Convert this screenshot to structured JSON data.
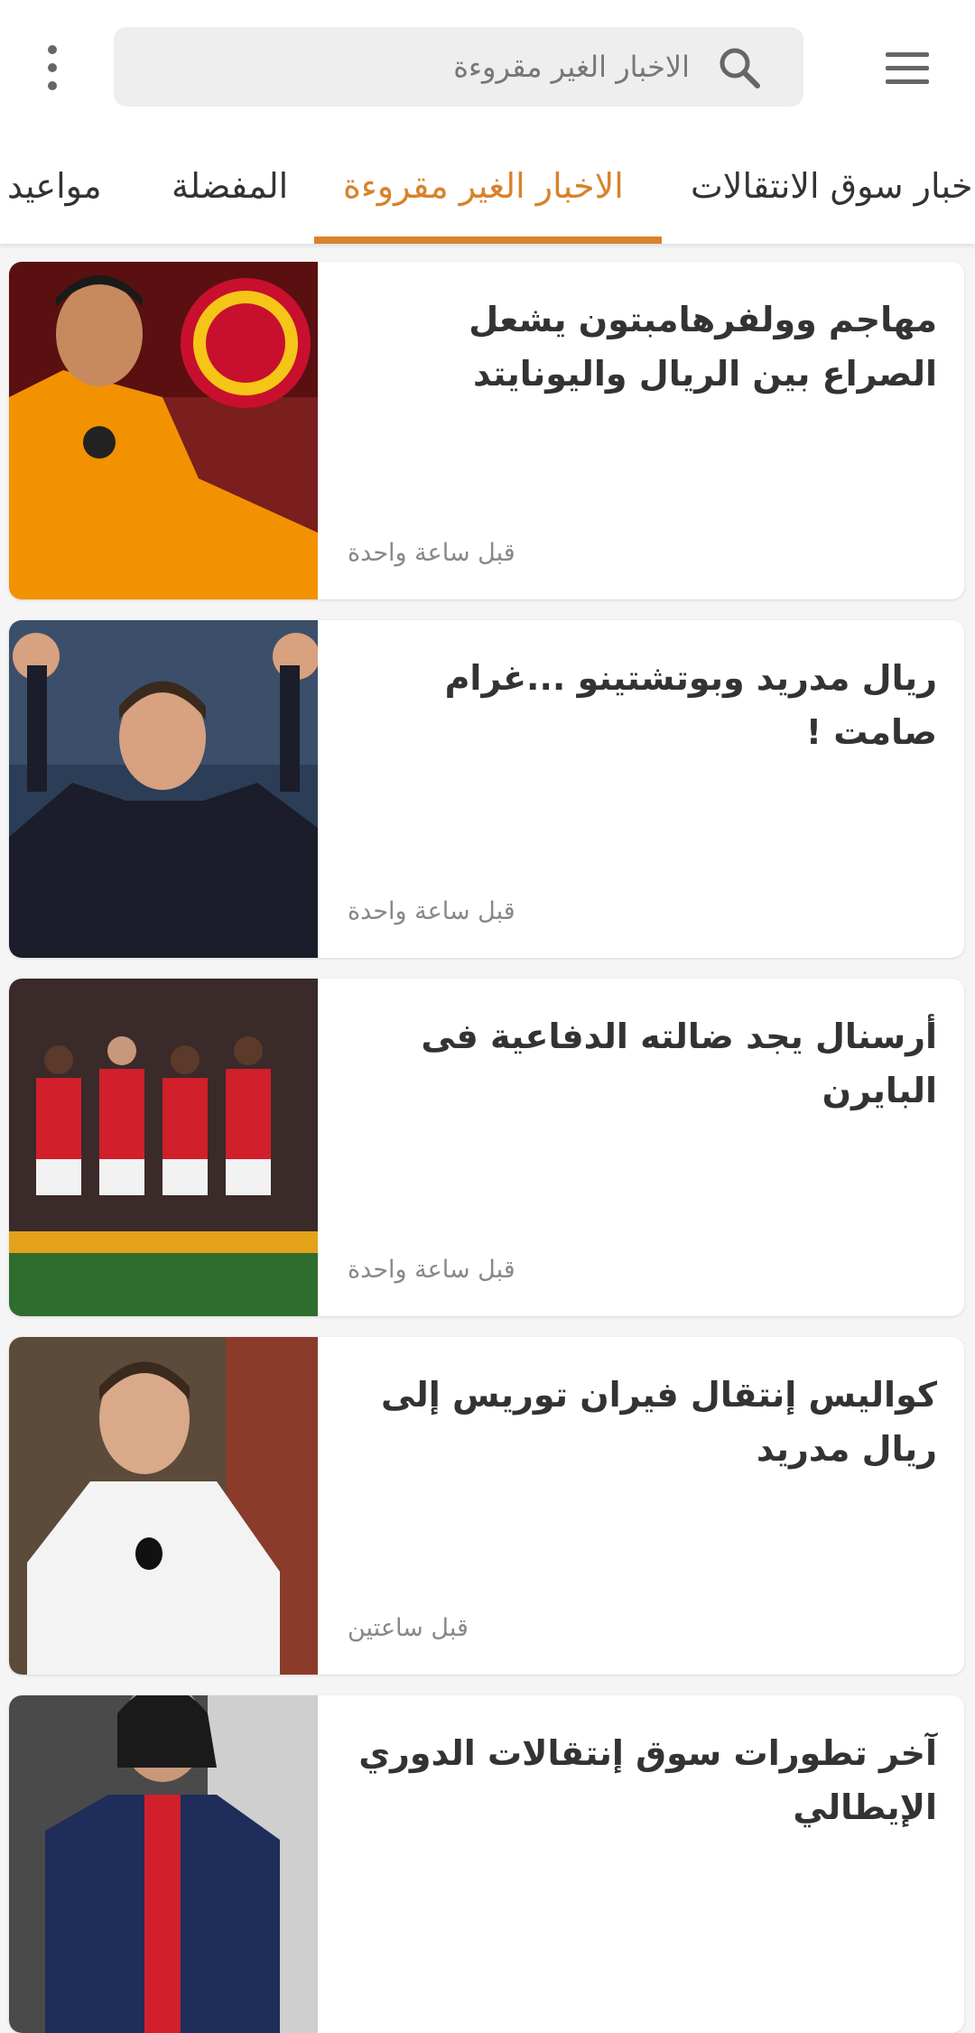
{
  "search": {
    "placeholder": "الاخبار الغير مقروءة"
  },
  "tabs": [
    {
      "label": "اخبار سوق الانتقالات",
      "active": false
    },
    {
      "label": "الاخبار الغير مقروءة",
      "active": true
    },
    {
      "label": "المفضلة",
      "active": false
    },
    {
      "label": "مواعيد",
      "active": false
    }
  ],
  "articles": [
    {
      "title": "مهاجم وولفرهامبتون يشعل الصراع بين الريال واليونايتد",
      "time": "قبل ساعة واحدة"
    },
    {
      "title": "ريال مدريد وبوتشتينو ...غرام صامت !",
      "time": "قبل ساعة واحدة"
    },
    {
      "title": "أرسنال يجد ضالته الدفاعية فى البايرن",
      "time": "قبل ساعة واحدة"
    },
    {
      "title": "كواليس إنتقال فيران توريس إلى ريال مدريد",
      "time": "قبل ساعتين"
    },
    {
      "title": "آخر تطورات سوق إنتقالات الدوري الإيطالي",
      "time": ""
    }
  ],
  "colors": {
    "accent": "#d9822b",
    "text": "#333333",
    "muted": "#888888"
  }
}
